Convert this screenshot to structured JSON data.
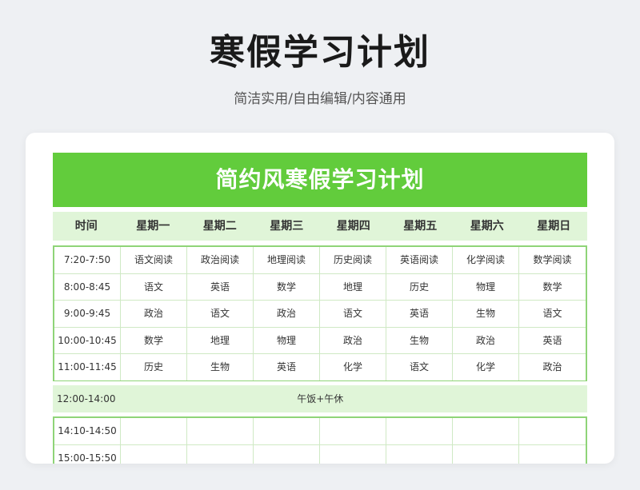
{
  "page": {
    "title": "寒假学习计划",
    "subtitle": "简洁实用/自由编辑/内容通用"
  },
  "sheet": {
    "banner": "简约风寒假学习计划",
    "headers": [
      "时间",
      "星期一",
      "星期二",
      "星期三",
      "星期四",
      "星期五",
      "星期六",
      "星期日"
    ],
    "morning_rows": [
      [
        "7:20-7:50",
        "语文阅读",
        "政治阅读",
        "地理阅读",
        "历史阅读",
        "英语阅读",
        "化学阅读",
        "数学阅读"
      ],
      [
        "8:00-8:45",
        "语文",
        "英语",
        "数学",
        "地理",
        "历史",
        "物理",
        "数学"
      ],
      [
        "9:00-9:45",
        "政治",
        "语文",
        "政治",
        "语文",
        "英语",
        "生物",
        "语文"
      ],
      [
        "10:00-10:45",
        "数学",
        "地理",
        "物理",
        "政治",
        "生物",
        "政治",
        "英语"
      ],
      [
        "11:00-11:45",
        "历史",
        "生物",
        "英语",
        "化学",
        "语文",
        "化学",
        "政治"
      ]
    ],
    "lunch": {
      "time": "12:00-14:00",
      "text": "午饭+午休"
    },
    "afternoon_rows": [
      [
        "14:10-14:50",
        "",
        "",
        "",
        "",
        "",
        "",
        ""
      ],
      [
        "15:00-15:50",
        "",
        "",
        "",
        "",
        "",
        "",
        ""
      ]
    ]
  },
  "colors": {
    "accent": "#62cc3c",
    "header_bg": "#e0f5d8",
    "border": "#8fd478"
  }
}
